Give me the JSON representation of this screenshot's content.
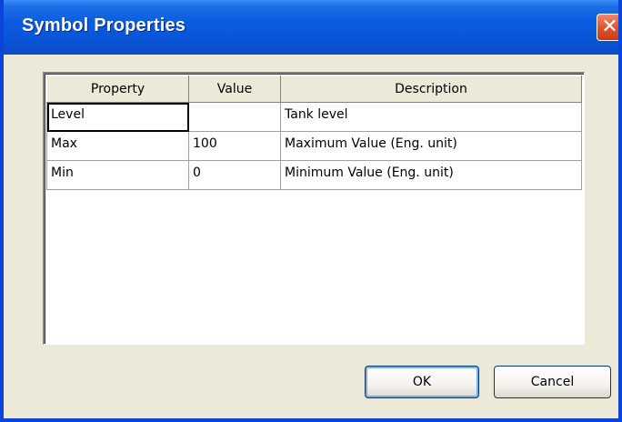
{
  "window": {
    "title": "Symbol Properties",
    "close_glyph": "✕"
  },
  "grid": {
    "columns": [
      "Property",
      "Value",
      "Description"
    ],
    "rows": [
      {
        "property": "Level",
        "value": "",
        "description": "Tank level"
      },
      {
        "property": "Max",
        "value": "100",
        "description": "Maximum Value (Eng. unit)"
      },
      {
        "property": "Min",
        "value": "0",
        "description": "Minimum Value (Eng. unit)"
      }
    ],
    "selected_cell": "Level"
  },
  "buttons": {
    "ok_label": "OK",
    "cancel_label": "Cancel"
  },
  "colors": {
    "titlebar": "#0a55d8",
    "close_button": "#e2562f",
    "dialog_face": "#ece9d8"
  },
  "icons": {
    "close": "close-icon"
  }
}
